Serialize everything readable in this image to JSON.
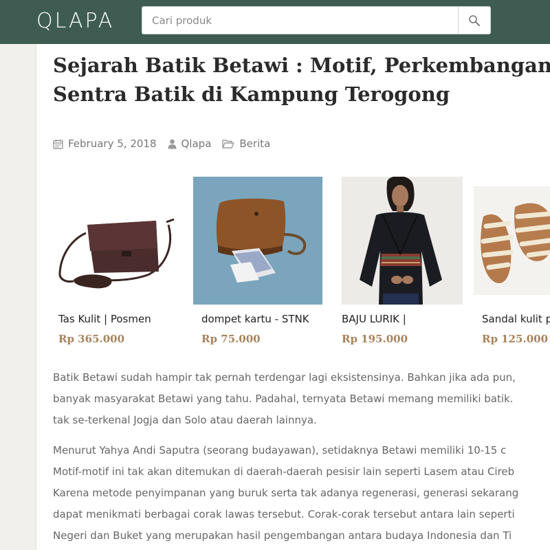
{
  "header": {
    "logo_text": "QLAPA",
    "search": {
      "placeholder": "Cari produk",
      "value": ""
    },
    "search_icon": "search-icon",
    "bg_color": "#3f5c52"
  },
  "article": {
    "title_lines": [
      "Sejarah Batik Betawi : Motif, Perkembangan &",
      "Sentra Batik di Kampung Terogong"
    ],
    "meta": {
      "date": "February 5, 2018",
      "date_icon": "calendar-icon",
      "author": "Qlapa",
      "author_icon": "user-icon",
      "category": "Berita",
      "category_icon": "folder-icon"
    },
    "products": [
      {
        "name": "Tas Kulit | Posmen",
        "price": "Rp 365.000",
        "image": "leather-bag"
      },
      {
        "name": "dompet kartu - STNK",
        "price": "Rp 75.000",
        "image": "leather-wallet"
      },
      {
        "name": "BAJU LURIK |",
        "price": "Rp 195.000",
        "image": "black-wrap-top"
      },
      {
        "name": "Sandal kulit pu",
        "price": "Rp 125.000",
        "image": "leather-sandals"
      }
    ],
    "paragraphs": [
      [
        "Batik Betawi sudah hampir tak pernah terdengar lagi eksistensinya. Bahkan jika ada pun,",
        "banyak masyarakat Betawi yang tahu. Padahal, ternyata Betawi memang memiliki batik.",
        "tak se-terkenal Jogja dan Solo atau daerah lainnya."
      ],
      [
        "Menurut Yahya Andi Saputra (seorang budayawan), setidaknya Betawi memiliki 10-15 c",
        "Motif-motif ini tak akan ditemukan di daerah-daerah pesisir lain seperti Lasem atau Cireb",
        "Karena metode penyimpanan yang buruk serta tak adanya regenerasi, generasi sekarang",
        "dapat menikmati berbagai corak lawas tersebut. Corak-corak tersebut antara lain seperti",
        "Negeri dan Buket yang merupakan hasil pengembangan antara budaya Indonesia dan Ti"
      ]
    ],
    "price_color": "#a8835a"
  }
}
